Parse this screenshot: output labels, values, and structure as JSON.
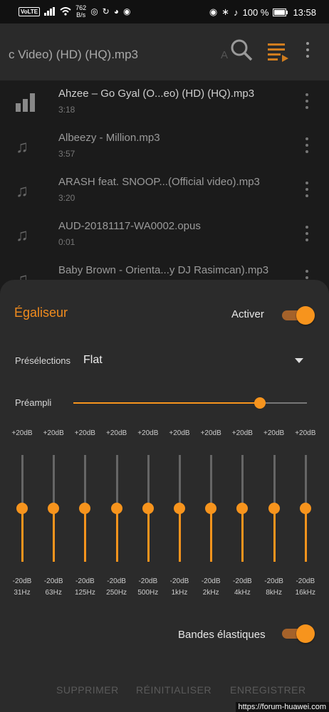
{
  "status_bar": {
    "volte": "VoLTE",
    "speed_value": "762",
    "speed_unit": "B/s",
    "battery": "100 %",
    "time": "13:58"
  },
  "header": {
    "title": "c Video) (HD) (HQ).mp3",
    "ghost_letter": "A",
    "icons": [
      "search-icon",
      "queue-icon",
      "more-vert-icon"
    ],
    "accent": "#f28c1e"
  },
  "tracks": [
    {
      "title": "Ahzee – Go Gyal (O...eo) (HD) (HQ).mp3",
      "duration": "3:18",
      "playing": true
    },
    {
      "title": "Albeezy - Million.mp3",
      "duration": "3:57",
      "playing": false
    },
    {
      "title": "ARASH feat. SNOOP...(Official video).mp3",
      "duration": "3:20",
      "playing": false
    },
    {
      "title": "AUD-20181117-WA0002.opus",
      "duration": "0:01",
      "playing": false
    },
    {
      "title": "Baby Brown - Orienta...y DJ Rasimcan).mp3",
      "duration": "",
      "playing": false
    }
  ],
  "equalizer": {
    "title": "Égaliseur",
    "enable_label": "Activer",
    "enabled": true,
    "presets_label": "Présélections",
    "preset_value": "Flat",
    "preamp_label": "Préampli",
    "preamp_fraction": 0.8,
    "bands": [
      {
        "freq": "31Hz",
        "max": "+20dB",
        "min": "-20dB",
        "gain_db": 0
      },
      {
        "freq": "63Hz",
        "max": "+20dB",
        "min": "-20dB",
        "gain_db": 0
      },
      {
        "freq": "125Hz",
        "max": "+20dB",
        "min": "-20dB",
        "gain_db": 0
      },
      {
        "freq": "250Hz",
        "max": "+20dB",
        "min": "-20dB",
        "gain_db": 0
      },
      {
        "freq": "500Hz",
        "max": "+20dB",
        "min": "-20dB",
        "gain_db": 0
      },
      {
        "freq": "1kHz",
        "max": "+20dB",
        "min": "-20dB",
        "gain_db": 0
      },
      {
        "freq": "2kHz",
        "max": "+20dB",
        "min": "-20dB",
        "gain_db": 0
      },
      {
        "freq": "4kHz",
        "max": "+20dB",
        "min": "-20dB",
        "gain_db": 0
      },
      {
        "freq": "8kHz",
        "max": "+20dB",
        "min": "-20dB",
        "gain_db": 0
      },
      {
        "freq": "16kHz",
        "max": "+20dB",
        "min": "-20dB",
        "gain_db": 0
      }
    ],
    "elastic_label": "Bandes élastiques",
    "elastic_enabled": true,
    "actions": {
      "delete": "SUPPRIMER",
      "reset": "RÉINITIALISER",
      "save": "ENREGISTRER"
    }
  },
  "watermark": "https://forum-huawei.com"
}
